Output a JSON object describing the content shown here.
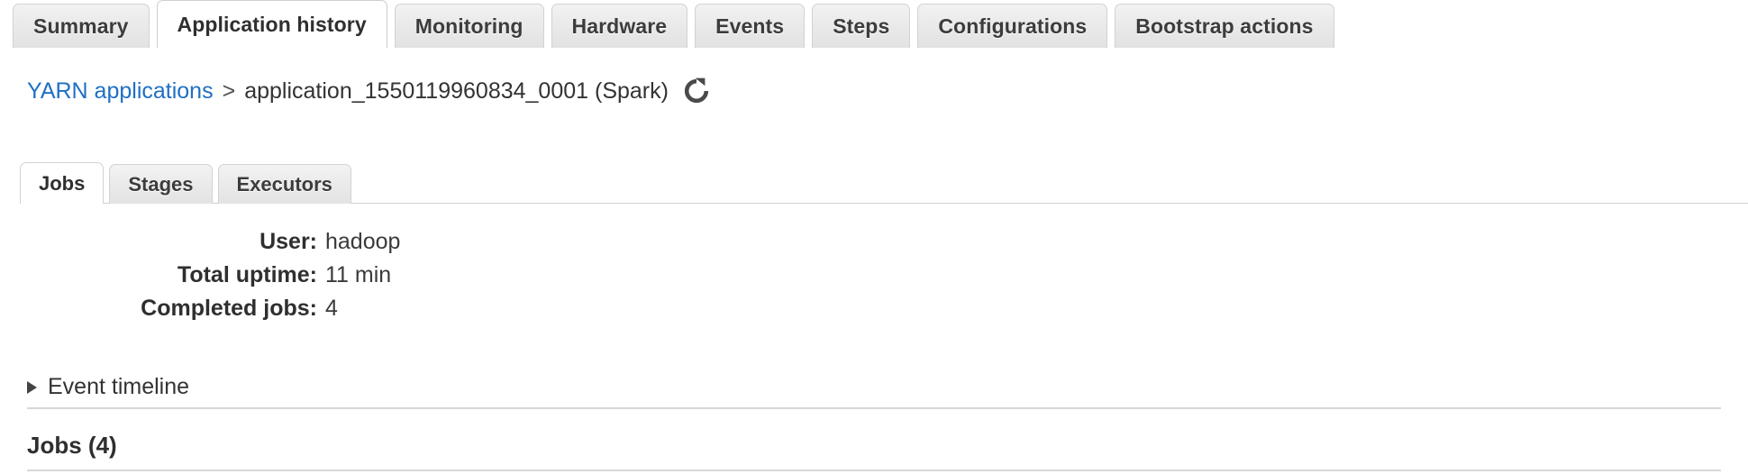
{
  "console_tabs": [
    {
      "label": "Summary",
      "active": false
    },
    {
      "label": "Application history",
      "active": true
    },
    {
      "label": "Monitoring",
      "active": false
    },
    {
      "label": "Hardware",
      "active": false
    },
    {
      "label": "Events",
      "active": false
    },
    {
      "label": "Steps",
      "active": false
    },
    {
      "label": "Configurations",
      "active": false
    },
    {
      "label": "Bootstrap actions",
      "active": false
    }
  ],
  "breadcrumb": {
    "root_label": "YARN applications",
    "separator": ">",
    "current_label": "application_1550119960834_0001 (Spark)",
    "refresh_icon": "refresh-icon"
  },
  "spark_tabs": [
    {
      "label": "Jobs",
      "active": true
    },
    {
      "label": "Stages",
      "active": false
    },
    {
      "label": "Executors",
      "active": false
    }
  ],
  "summary": [
    {
      "key": "User:",
      "value": "hadoop"
    },
    {
      "key": "Total uptime:",
      "value": "11 min"
    },
    {
      "key": "Completed jobs:",
      "value": "4"
    }
  ],
  "event_timeline": {
    "label": "Event timeline",
    "expanded": false,
    "disclosure_icon": "triangle-right-icon"
  },
  "jobs_section": {
    "heading": "Jobs (4)"
  },
  "colors": {
    "link": "#1f6fc4",
    "text": "#333333",
    "tab_face": "#eaeaea",
    "tab_active_face": "#ffffff",
    "border": "#d2d2d2",
    "rule": "#d7d7d7"
  }
}
